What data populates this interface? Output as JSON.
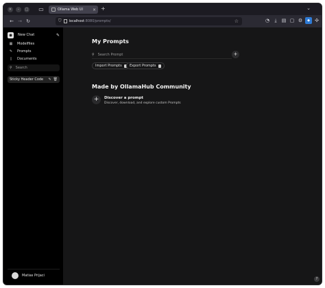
{
  "browser": {
    "tab_title": "Ollama Web UI",
    "url_host": "localhost",
    "url_path": ":8080/prompts/",
    "new_tab_symbol": "+",
    "tab_close_symbol": "×"
  },
  "sidebar": {
    "new_chat_label": "New Chat",
    "items": [
      {
        "label": "Modelfiles",
        "icon": "grid-icon"
      },
      {
        "label": "Prompts",
        "icon": "pencil-icon"
      },
      {
        "label": "Documents",
        "icon": "document-icon"
      }
    ],
    "search_placeholder": "Search",
    "chats": [
      {
        "label": "Sticky Header Code"
      }
    ],
    "user_name": "Matias Prijaci"
  },
  "main": {
    "title": "My Prompts",
    "search_placeholder": "Search Prompt",
    "add_symbol": "+",
    "import_label": "Import Prompts",
    "export_label": "Export Prompts",
    "community_title": "Made by OllamaHub Community",
    "discover_title": "Discover a prompt",
    "discover_subtitle": "Discover, download, and explore custom Prompts",
    "help_symbol": "?"
  },
  "colors": {
    "sidebar_bg": "#000000",
    "main_bg": "#161617",
    "text": "#e5e5e5"
  }
}
